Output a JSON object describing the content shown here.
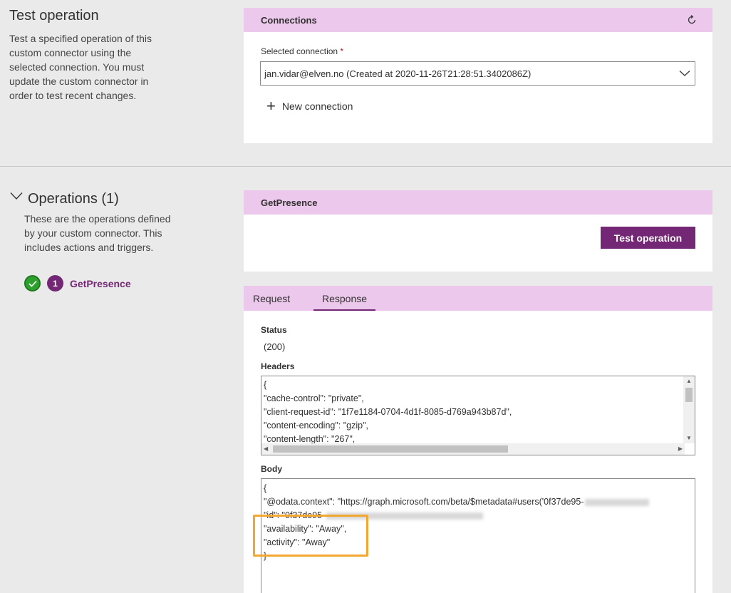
{
  "test_operation": {
    "title": "Test operation",
    "description": "Test a specified operation of this custom connector using the selected connection. You must update the custom connector in order to test recent changes."
  },
  "connections": {
    "header": "Connections",
    "refresh_icon": "refresh-icon",
    "selected_label": "Selected connection",
    "required_mark": "*",
    "selected_value": "jan.vidar@elven.no (Created at 2020-11-26T21:28:51.3402086Z)",
    "new_connection_label": "New connection"
  },
  "operations": {
    "title": "Operations (1)",
    "description": "These are the operations defined by your custom connector. This includes actions and triggers.",
    "items": [
      {
        "number": "1",
        "name": "GetPresence",
        "status": "success"
      }
    ]
  },
  "getpresence": {
    "header": "GetPresence",
    "test_button": "Test operation"
  },
  "response": {
    "tabs": [
      {
        "label": "Request",
        "active": false
      },
      {
        "label": "Response",
        "active": true
      }
    ],
    "status_label": "Status",
    "status_value": "(200)",
    "headers_label": "Headers",
    "headers_lines": [
      "{",
      "  \"cache-control\": \"private\",",
      "  \"client-request-id\": \"1f7e1184-0704-4d1f-8085-d769a943b87d\",",
      "  \"content-encoding\": \"gzip\",",
      "  \"content-length\": \"267\","
    ],
    "body_label": "Body",
    "body_lines": [
      "{",
      "  \"@odata.context\": \"https://graph.microsoft.com/beta/$metadata#users('0f37de95-",
      "  \"id\": \"0f37de95-",
      "  \"availability\": \"Away\",",
      "  \"activity\": \"Away\"",
      "}"
    ]
  },
  "colors": {
    "accent": "#742774",
    "header_bg": "#ecc8ec",
    "success": "#2ea02e",
    "highlight": "#f2a830"
  }
}
